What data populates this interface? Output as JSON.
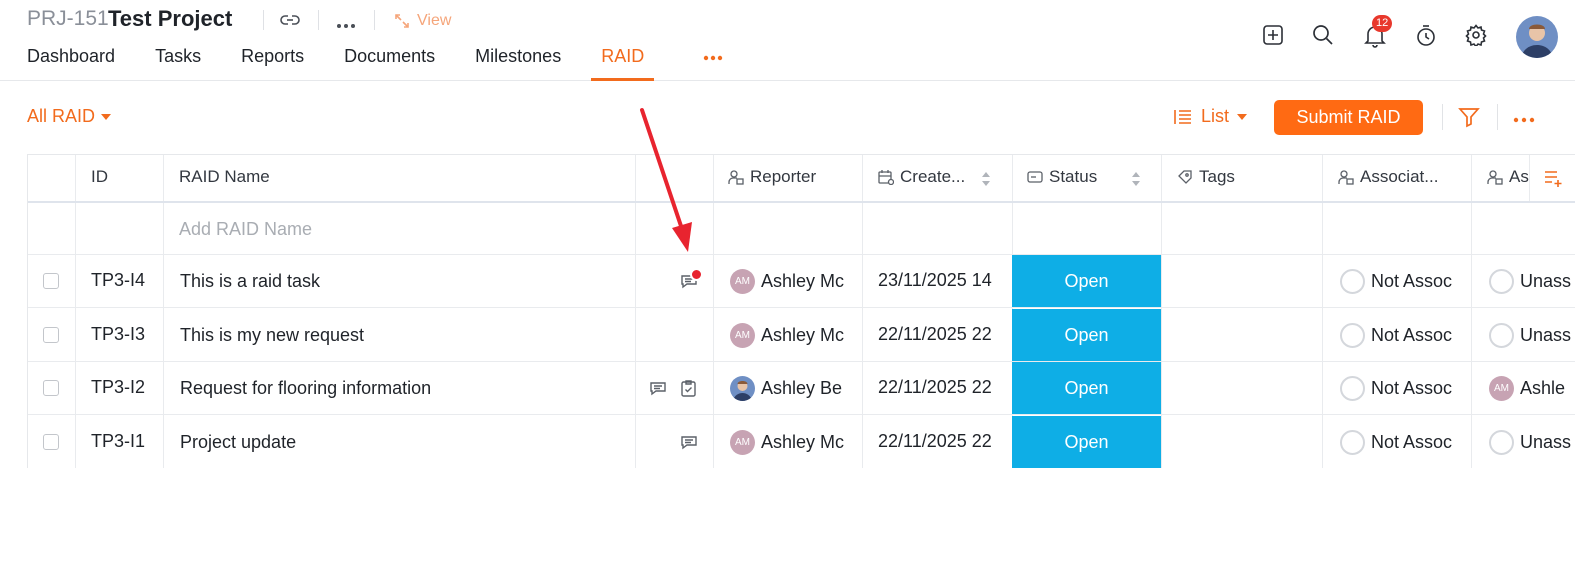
{
  "header": {
    "project_id": "PRJ-151",
    "project_name": "Test Project",
    "view_label": "View",
    "notification_count": "12",
    "tabs": [
      {
        "label": "Dashboard",
        "active": false
      },
      {
        "label": "Tasks",
        "active": false
      },
      {
        "label": "Reports",
        "active": false
      },
      {
        "label": "Documents",
        "active": false
      },
      {
        "label": "Milestones",
        "active": false
      },
      {
        "label": "RAID",
        "active": true
      }
    ]
  },
  "toolbar": {
    "filter_view": "All RAID",
    "layout": "List",
    "submit_label": "Submit RAID"
  },
  "table": {
    "columns": [
      "ID",
      "RAID Name",
      "Reporter",
      "Create...",
      "Status",
      "Tags",
      "Associat...",
      "As"
    ],
    "add_placeholder": "Add RAID Name",
    "rows": [
      {
        "id": "TP3-I4",
        "name": "This is a raid task",
        "reporter": "Ashley Mc",
        "reporter_initials": "AM",
        "created": "23/11/2025 14",
        "status": "Open",
        "associated": "Not Assoc",
        "assignee": "Unass",
        "icons": [
          "comment-unread-icon"
        ]
      },
      {
        "id": "TP3-I3",
        "name": "This is my new request",
        "reporter": "Ashley Mc",
        "reporter_initials": "AM",
        "created": "22/11/2025 22",
        "status": "Open",
        "associated": "Not Assoc",
        "assignee": "Unass",
        "icons": []
      },
      {
        "id": "TP3-I2",
        "name": "Request for flooring information",
        "reporter": "Ashley Be",
        "reporter_initials": "",
        "created": "22/11/2025 22",
        "status": "Open",
        "associated": "Not Assoc",
        "assignee": "Ashle",
        "assignee_initials": "AM",
        "icons": [
          "comment-icon",
          "clipboard-check-icon"
        ]
      },
      {
        "id": "TP3-I1",
        "name": "Project update",
        "reporter": "Ashley Mc",
        "reporter_initials": "AM",
        "created": "22/11/2025 22",
        "status": "Open",
        "associated": "Not Assoc",
        "assignee": "Unass",
        "icons": [
          "comment-icon"
        ]
      }
    ]
  },
  "colors": {
    "accent": "#f26b1d",
    "status_open": "#0eaee6",
    "annotation_arrow": "#e8242f"
  }
}
